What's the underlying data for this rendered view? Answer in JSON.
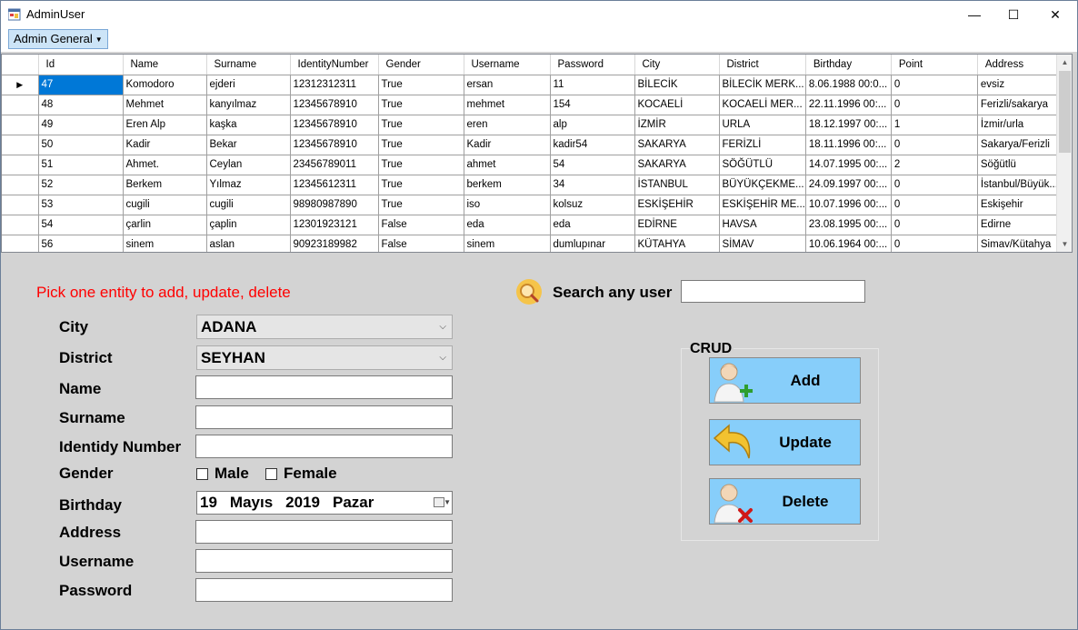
{
  "window": {
    "title": "AdminUser",
    "controls": {
      "minimize": "—",
      "maximize": "☐",
      "close": "✕"
    }
  },
  "menu": {
    "admin_general": "Admin General"
  },
  "grid": {
    "columns": [
      "Id",
      "Name",
      "Surname",
      "IdentityNumber",
      "Gender",
      "Username",
      "Password",
      "City",
      "District",
      "Birthday",
      "Point",
      "Address"
    ],
    "rows": [
      [
        "47",
        "Komodoro",
        "ejderi",
        "12312312311",
        "True",
        "ersan",
        "11",
        "BİLECİK",
        "BİLECİK MERK...",
        "8.06.1988 00:0...",
        "0",
        "evsiz"
      ],
      [
        "48",
        "Mehmet",
        "kanyılmaz",
        "12345678910",
        "True",
        "mehmet",
        "154",
        "KOCAELİ",
        "KOCAELİ MER...",
        "22.11.1996 00:...",
        "0",
        "Ferizli/sakarya"
      ],
      [
        "49",
        "Eren Alp",
        "kaşka",
        "12345678910",
        "True",
        "eren",
        "alp",
        "İZMİR",
        "URLA",
        "18.12.1997 00:...",
        "1",
        "İzmir/urla"
      ],
      [
        "50",
        "Kadir",
        "Bekar",
        "12345678910",
        "True",
        "Kadir",
        "kadir54",
        "SAKARYA",
        "FERİZLİ",
        "18.11.1996 00:...",
        "0",
        "Sakarya/Ferizli"
      ],
      [
        "51",
        "Ahmet.",
        "Ceylan",
        "23456789011",
        "True",
        "ahmet",
        "54",
        "SAKARYA",
        "SÖĞÜTLÜ",
        "14.07.1995 00:...",
        "2",
        "Söğütlü"
      ],
      [
        "52",
        "Berkem",
        "Yılmaz",
        "12345612311",
        "True",
        "berkem",
        "34",
        "İSTANBUL",
        "BÜYÜKÇEKME...",
        "24.09.1997 00:...",
        "0",
        "İstanbul/Büyük..."
      ],
      [
        "53",
        "cugili",
        "cugili",
        "98980987890",
        "True",
        "iso",
        "kolsuz",
        "ESKİŞEHİR",
        "ESKİŞEHİR ME...",
        "10.07.1996 00:...",
        "0",
        "Eskişehir"
      ],
      [
        "54",
        "çarlin",
        "çaplin",
        "12301923121",
        "False",
        "eda",
        "eda",
        "EDİRNE",
        "HAVSA",
        "23.08.1995 00:...",
        "0",
        "Edirne"
      ],
      [
        "56",
        "sinem",
        "aslan",
        "90923189982",
        "False",
        "sinem",
        "dumlupınar",
        "KÜTAHYA",
        "SİMAV",
        "10.06.1964 00:...",
        "0",
        "Simav/Kütahya"
      ]
    ],
    "current_row_marker": "▶"
  },
  "form": {
    "instruction": "Pick one entity to add, update, delete",
    "city_label": "City",
    "city_value": "ADANA",
    "district_label": "District",
    "district_value": "SEYHAN",
    "name_label": "Name",
    "surname_label": "Surname",
    "identity_label": "Identidy Number",
    "gender_label": "Gender",
    "male_label": "Male",
    "female_label": "Female",
    "birthday_label": "Birthday",
    "birthday": {
      "day": "19",
      "month": "Mayıs",
      "year": "2019",
      "weekday": "Pazar"
    },
    "address_label": "Address",
    "username_label": "Username",
    "password_label": "Password"
  },
  "search": {
    "label": "Search any user"
  },
  "crud": {
    "group_label": "CRUD",
    "add": "Add",
    "update": "Update",
    "delete": "Delete"
  },
  "colors": {
    "window_bg": "#d3d3d3",
    "selection": "#0078d7",
    "crud_button": "#87cefa",
    "instruction_text": "#ff0000"
  }
}
